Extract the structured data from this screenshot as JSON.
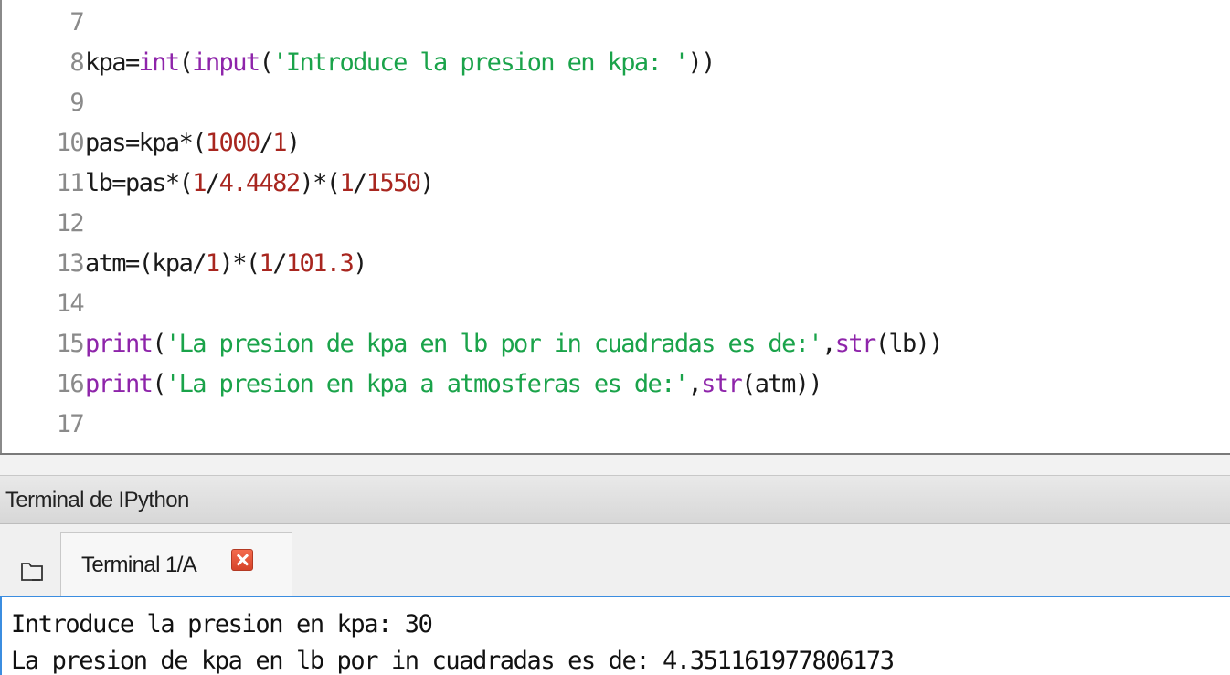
{
  "editor": {
    "lines": [
      {
        "num": "7",
        "tokens": []
      },
      {
        "num": "8",
        "tokens": [
          [
            "id",
            "kpa="
          ],
          [
            "bi",
            "int"
          ],
          [
            "id",
            "("
          ],
          [
            "bi",
            "input"
          ],
          [
            "id",
            "("
          ],
          [
            "str",
            "'Introduce la presion en kpa: '"
          ],
          [
            "id",
            "))"
          ]
        ]
      },
      {
        "num": "9",
        "tokens": []
      },
      {
        "num": "10",
        "tokens": [
          [
            "id",
            "pas=kpa*("
          ],
          [
            "num",
            "1000"
          ],
          [
            "id",
            "/"
          ],
          [
            "num",
            "1"
          ],
          [
            "id",
            ")"
          ]
        ]
      },
      {
        "num": "11",
        "tokens": [
          [
            "id",
            "lb=pas*("
          ],
          [
            "num",
            "1"
          ],
          [
            "id",
            "/"
          ],
          [
            "num",
            "4.4482"
          ],
          [
            "id",
            ")*("
          ],
          [
            "num",
            "1"
          ],
          [
            "id",
            "/"
          ],
          [
            "num",
            "1550"
          ],
          [
            "id",
            ")"
          ]
        ]
      },
      {
        "num": "12",
        "tokens": []
      },
      {
        "num": "13",
        "tokens": [
          [
            "id",
            "atm=(kpa/"
          ],
          [
            "num",
            "1"
          ],
          [
            "id",
            ")*("
          ],
          [
            "num",
            "1"
          ],
          [
            "id",
            "/"
          ],
          [
            "num",
            "101.3"
          ],
          [
            "id",
            ")"
          ]
        ]
      },
      {
        "num": "14",
        "tokens": []
      },
      {
        "num": "15",
        "tokens": [
          [
            "bi",
            "print"
          ],
          [
            "id",
            "("
          ],
          [
            "str",
            "'La presion de kpa en lb por in cuadradas es de:'"
          ],
          [
            "id",
            ","
          ],
          [
            "bi",
            "str"
          ],
          [
            "id",
            "(lb))"
          ]
        ]
      },
      {
        "num": "16",
        "tokens": [
          [
            "bi",
            "print"
          ],
          [
            "id",
            "("
          ],
          [
            "str",
            "'La presion en kpa a atmosferas es de:'"
          ],
          [
            "id",
            ","
          ],
          [
            "bi",
            "str"
          ],
          [
            "id",
            "(atm))"
          ]
        ]
      },
      {
        "num": "17",
        "tokens": []
      }
    ]
  },
  "pane": {
    "title": "Terminal de IPython"
  },
  "tabs": [
    {
      "label": "Terminal 1/A"
    }
  ],
  "icons": {
    "tab_close": "close-icon",
    "folder": "folder-icon"
  },
  "console": {
    "lines": [
      "Introduce la presion en kpa: 30",
      "La presion de kpa en lb por in cuadradas es de: 4.351161977806173"
    ]
  }
}
